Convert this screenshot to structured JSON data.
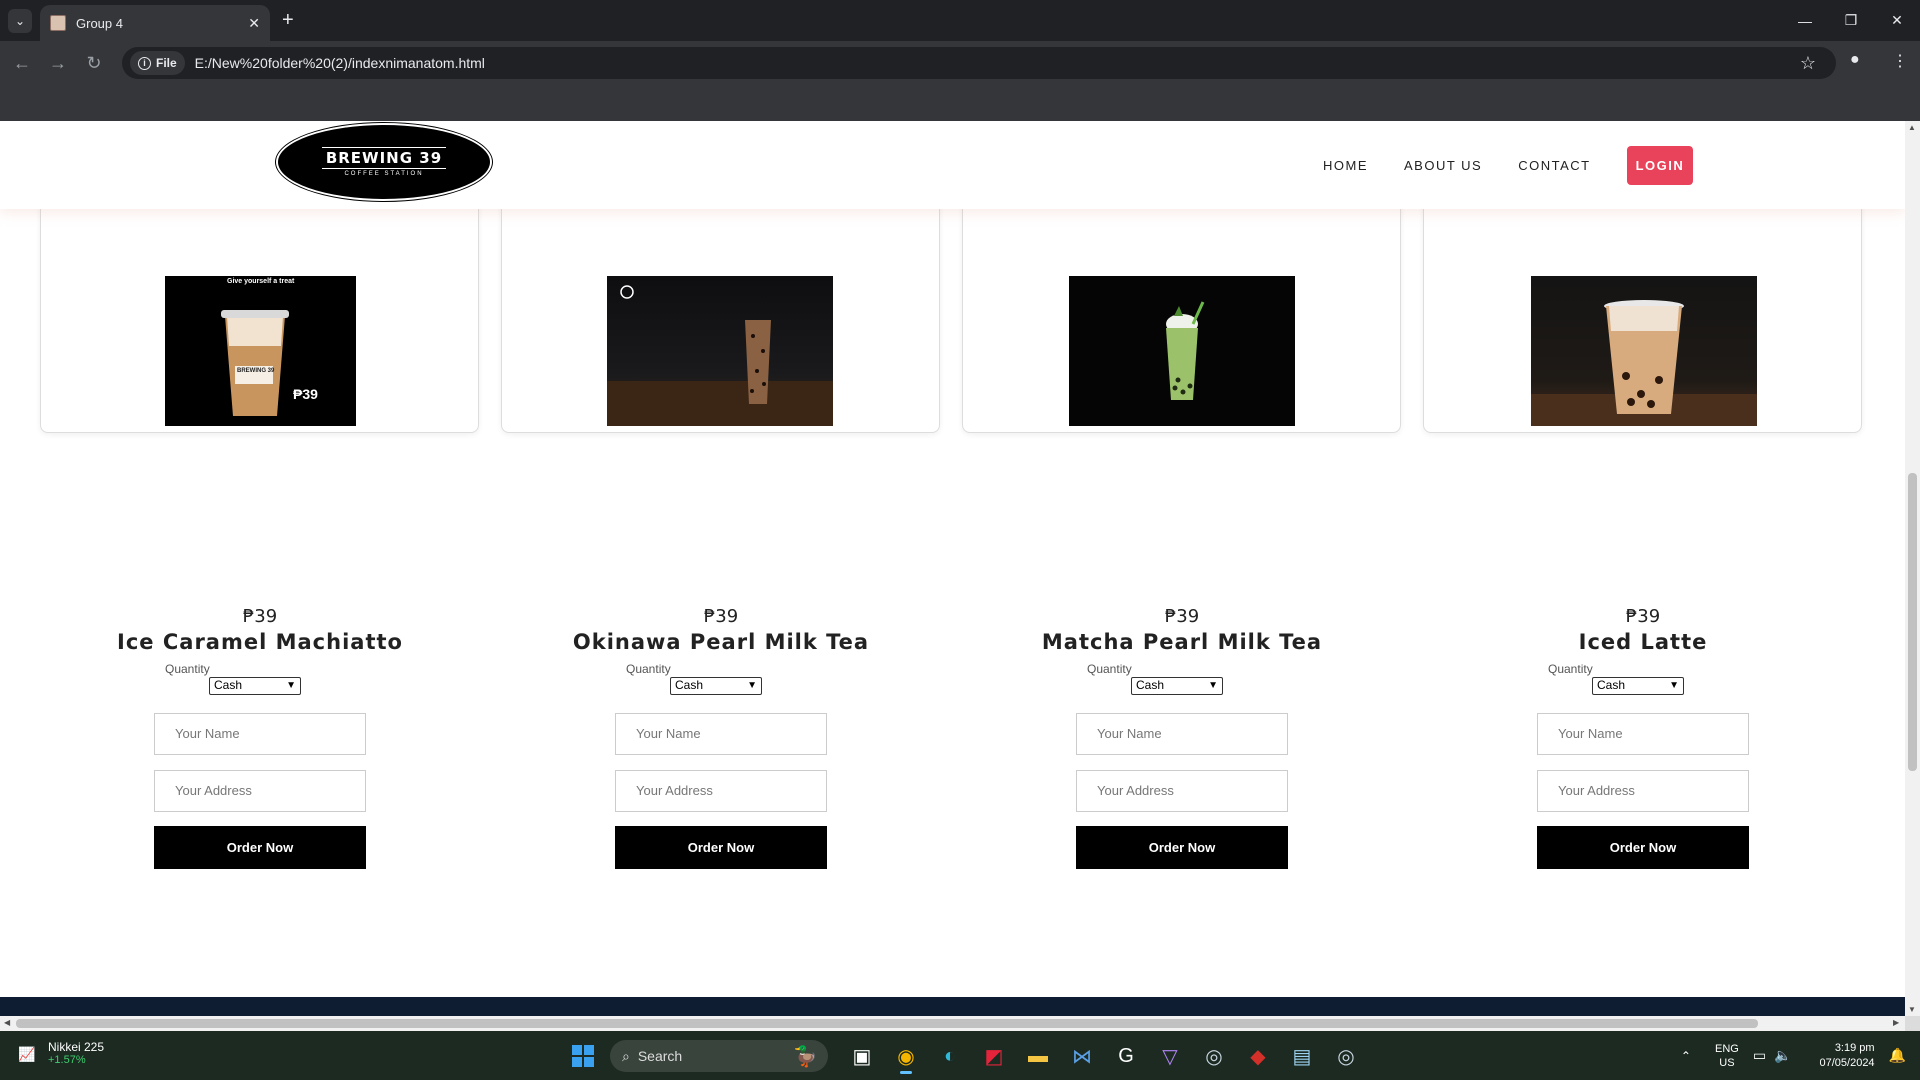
{
  "browser": {
    "tab_title": "Group 4",
    "site_chip": "File",
    "url": "E:/New%20folder%20(2)/indexnimanatom.html"
  },
  "site": {
    "logo_main": "BREWING 39",
    "logo_sub": "COFFEE STATION",
    "nav": {
      "home": "HOME",
      "about": "ABOUT US",
      "contact": "CONTACT",
      "login": "LOGIN"
    }
  },
  "products": [
    {
      "price": "₱39",
      "name": "Ice Caramel Machiatto",
      "qty_label": "Quantity",
      "select_value": "Cash",
      "name_placeholder": "Your Name",
      "address_placeholder": "Your Address",
      "order_label": "Order Now",
      "image_caption": "Give yourself a treat",
      "image_price": "₱39",
      "image_brand": "BREWING 39"
    },
    {
      "price": "₱39",
      "name": "Okinawa Pearl Milk Tea",
      "qty_label": "Quantity",
      "select_value": "Cash",
      "name_placeholder": "Your Name",
      "address_placeholder": "Your Address",
      "order_label": "Order Now"
    },
    {
      "price": "₱39",
      "name": "Matcha Pearl Milk Tea",
      "qty_label": "Quantity",
      "select_value": "Cash",
      "name_placeholder": "Your Name",
      "address_placeholder": "Your Address",
      "order_label": "Order Now"
    },
    {
      "price": "₱39",
      "name": "Iced Latte",
      "qty_label": "Quantity",
      "select_value": "Cash",
      "name_placeholder": "Your Name",
      "address_placeholder": "Your Address",
      "order_label": "Order Now"
    }
  ],
  "taskbar": {
    "widget_title": "Nikkei 225",
    "widget_change": "+1.57%",
    "search_label": "Search",
    "lang_top": "ENG",
    "lang_bottom": "US",
    "time": "3:19 pm",
    "date": "07/05/2024"
  },
  "colors": {
    "login_button": "#e9425b",
    "order_button": "#000000",
    "footer": "#0f1d33"
  }
}
